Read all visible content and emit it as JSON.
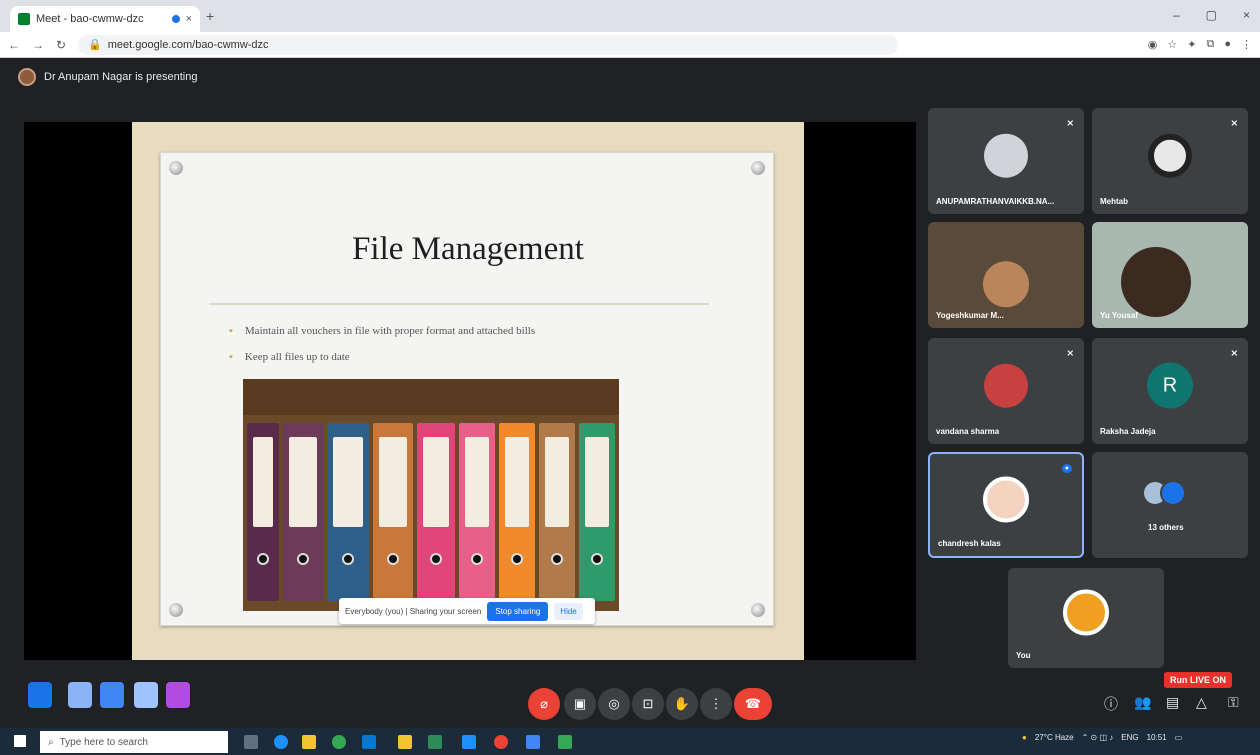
{
  "browser": {
    "tab_title": "Meet - bao-cwmw-dzc",
    "new_tab": "+",
    "url": "meet.google.com/bao-cwmw-dzc",
    "window_controls": [
      "–",
      "▢",
      "×"
    ]
  },
  "meet": {
    "presenting_text": "Dr Anupam Nagar is presenting",
    "slide": {
      "title": "File Management",
      "bullets": [
        "Maintain all vouchers in file with proper format and attached bills",
        "Keep all files up to date"
      ]
    },
    "share_bar": {
      "text": "Everybody (you) | Sharing your screen",
      "stop_label": "Stop sharing",
      "hide_label": "Hide"
    },
    "tiles": [
      {
        "name": "ANUPAMRATHANVAIKKB.NA...",
        "muted": true
      },
      {
        "name": "Mehtab",
        "muted": true
      },
      {
        "name": "Yogeshkumar M...",
        "muted": false
      },
      {
        "name": "Yu Yousaf",
        "muted": false
      },
      {
        "name": "vandana sharma",
        "muted": true
      },
      {
        "name": "Raksha Jadeja",
        "initial": "R",
        "muted": true
      },
      {
        "name": "chandresh kalas",
        "muted": false
      },
      {
        "name": "13 others",
        "muted": false
      },
      {
        "name": "You",
        "muted": false
      }
    ]
  },
  "toolbar": {
    "rec_label": "Run LIVE ON"
  },
  "taskbar": {
    "search_placeholder": "Type here to search",
    "weather": "27°C Haze",
    "lang": "ENG",
    "time": "10:51"
  }
}
